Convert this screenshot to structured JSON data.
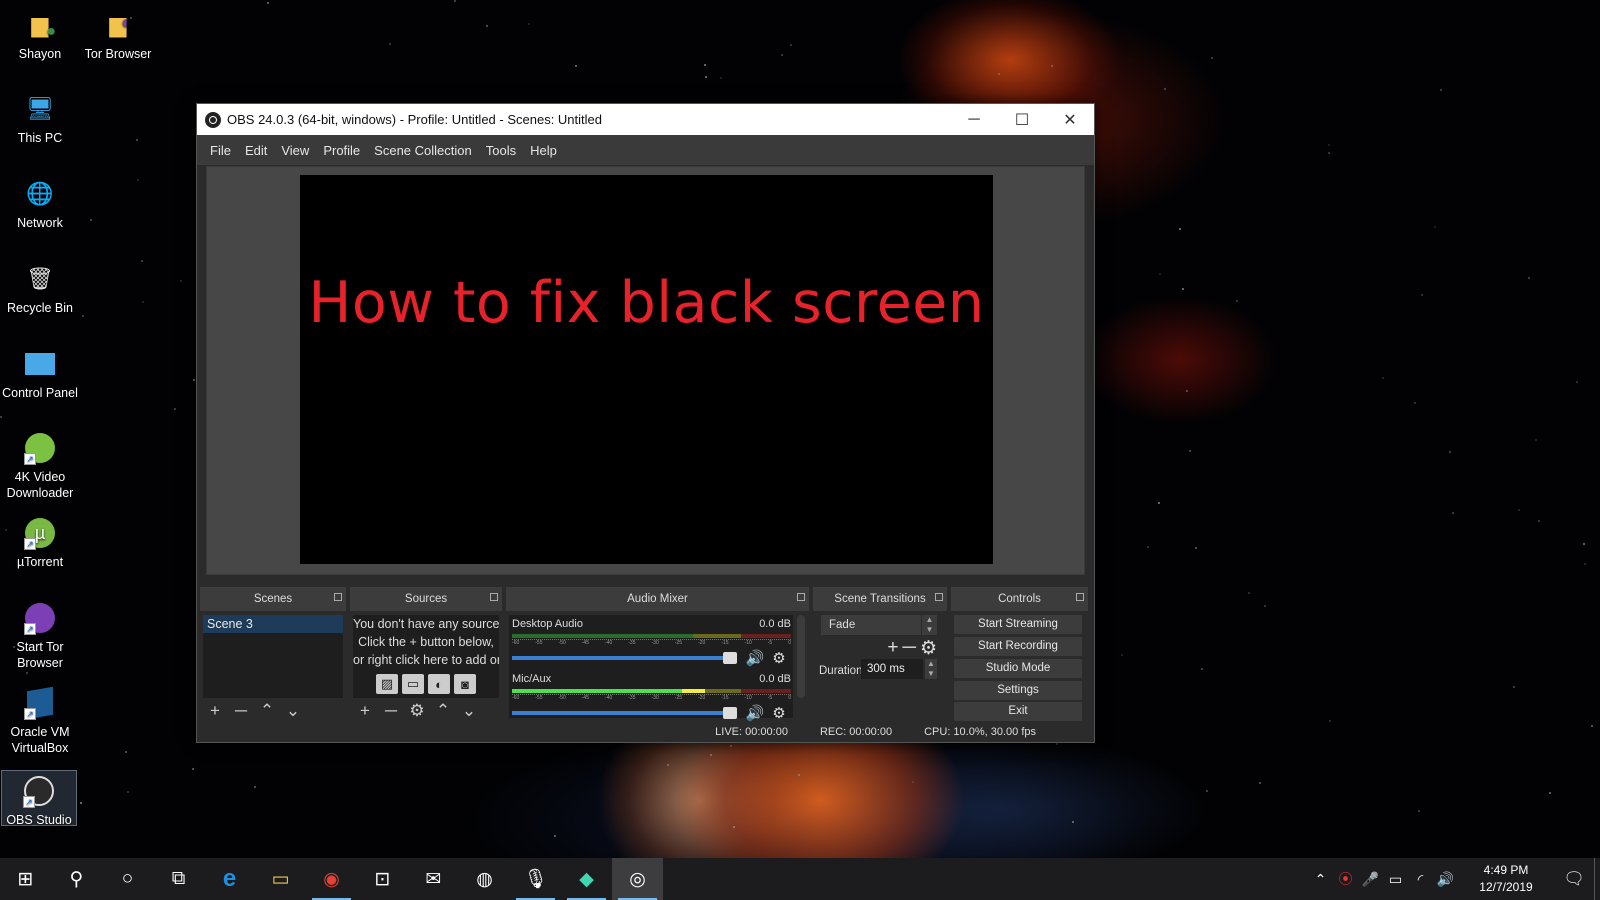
{
  "desktop": {
    "icons": [
      {
        "label": "Shayon",
        "icon": "user-folder-icon"
      },
      {
        "label": "Tor Browser",
        "icon": "tor-folder-icon"
      },
      {
        "label": "This PC",
        "icon": "computer-icon"
      },
      {
        "label": "Network",
        "icon": "network-icon"
      },
      {
        "label": "Recycle Bin",
        "icon": "recycle-bin-icon"
      },
      {
        "label": "Control Panel",
        "icon": "control-panel-icon"
      },
      {
        "label": "4K Video Downloader",
        "icon": "4k-video-downloader-icon"
      },
      {
        "label": "µTorrent",
        "icon": "utorrent-icon"
      },
      {
        "label": "Start Tor Browser",
        "icon": "tor-browser-icon"
      },
      {
        "label": "Oracle VM VirtualBox",
        "icon": "virtualbox-icon"
      },
      {
        "label": "OBS Studio",
        "icon": "obs-icon",
        "selected": true
      }
    ]
  },
  "window": {
    "title": "OBS 24.0.3 (64-bit, windows) - Profile: Untitled - Scenes: Untitled",
    "controls": {
      "minimize": "─",
      "maximize": "☐",
      "close": "✕"
    },
    "menu": [
      "File",
      "Edit",
      "View",
      "Profile",
      "Scene Collection",
      "Tools",
      "Help"
    ]
  },
  "preview": {
    "text": "How to fix black screen",
    "text_color": "#e8222b"
  },
  "docks": {
    "scenes": {
      "title": "Scenes",
      "items": [
        "Scene 3"
      ],
      "selected": "Scene 3",
      "toolbar": {
        "add": "+",
        "remove": "─",
        "up": "⌃",
        "down": "⌄"
      }
    },
    "sources": {
      "title": "Sources",
      "hint_lines": [
        "You don't have any sources.",
        "Click the + button below,",
        "or right click here to add one."
      ],
      "toolbar": {
        "add": "+",
        "remove": "─",
        "settings": "⚙",
        "up": "⌃",
        "down": "⌄"
      }
    },
    "audio_mixer": {
      "title": "Audio Mixer",
      "channels": [
        {
          "name": "Desktop Audio",
          "db": "0.0 dB",
          "level": 0.0,
          "volume": 1.0
        },
        {
          "name": "Mic/Aux",
          "db": "0.0 dB",
          "level": 0.69,
          "volume": 1.0
        }
      ],
      "ticks": [
        "-60",
        "-55",
        "-50",
        "-45",
        "-40",
        "-35",
        "-30",
        "-25",
        "-20",
        "-15",
        "-10",
        "-5",
        "0"
      ]
    },
    "scene_transitions": {
      "title": "Scene Transitions",
      "transition": "Fade",
      "duration_label": "Duration",
      "duration_value": "300 ms"
    },
    "controls": {
      "title": "Controls",
      "buttons": [
        "Start Streaming",
        "Start Recording",
        "Studio Mode",
        "Settings",
        "Exit"
      ]
    }
  },
  "status": {
    "live": "LIVE: 00:00:00",
    "rec": "REC: 00:00:00",
    "cpu": "CPU: 10.0%, 30.00 fps"
  },
  "taskbar": {
    "items": [
      {
        "name": "start",
        "glyph": "⊞"
      },
      {
        "name": "search",
        "glyph": "⚲"
      },
      {
        "name": "cortana",
        "glyph": "○"
      },
      {
        "name": "task-view",
        "glyph": "⧉"
      },
      {
        "name": "edge",
        "glyph": "e"
      },
      {
        "name": "file-explorer",
        "glyph": "▭"
      },
      {
        "name": "chrome",
        "glyph": "◉"
      },
      {
        "name": "store",
        "glyph": "⊡"
      },
      {
        "name": "mail",
        "glyph": "✉"
      },
      {
        "name": "xbox",
        "glyph": "◍"
      },
      {
        "name": "voice-recorder",
        "glyph": "🎙"
      },
      {
        "name": "filmora",
        "glyph": "◆"
      },
      {
        "name": "obs",
        "glyph": "◎"
      }
    ],
    "clock_time": "4:49 PM",
    "clock_date": "12/7/2019"
  }
}
